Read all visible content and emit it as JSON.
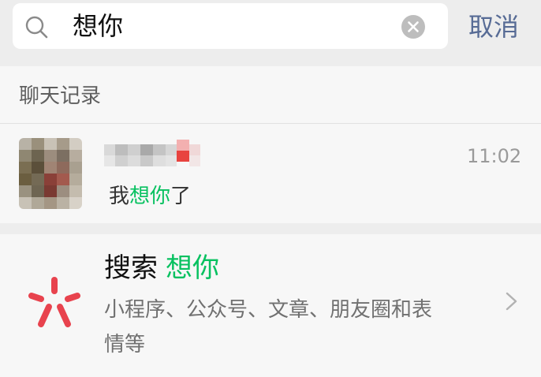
{
  "search": {
    "query": "想你",
    "cancel_label": "取消",
    "icon": "search-icon",
    "clear_icon": "clear-icon"
  },
  "chat_records": {
    "section_title": "聊天记录",
    "items": [
      {
        "sender": "(blurred)",
        "time": "11:02",
        "snippet_before": "我",
        "snippet_highlight": "想你",
        "snippet_after": "了"
      }
    ]
  },
  "suggestion": {
    "prefix": "搜索",
    "keyword": "想你",
    "description": "小程序、公众号、文章、朋友圈和表情等",
    "icon": "search-discover-icon",
    "chevron": "chevron-right-icon"
  },
  "colors": {
    "highlight": "#07c160",
    "cancel": "#576b95",
    "brand_icon": "#e8434e"
  }
}
